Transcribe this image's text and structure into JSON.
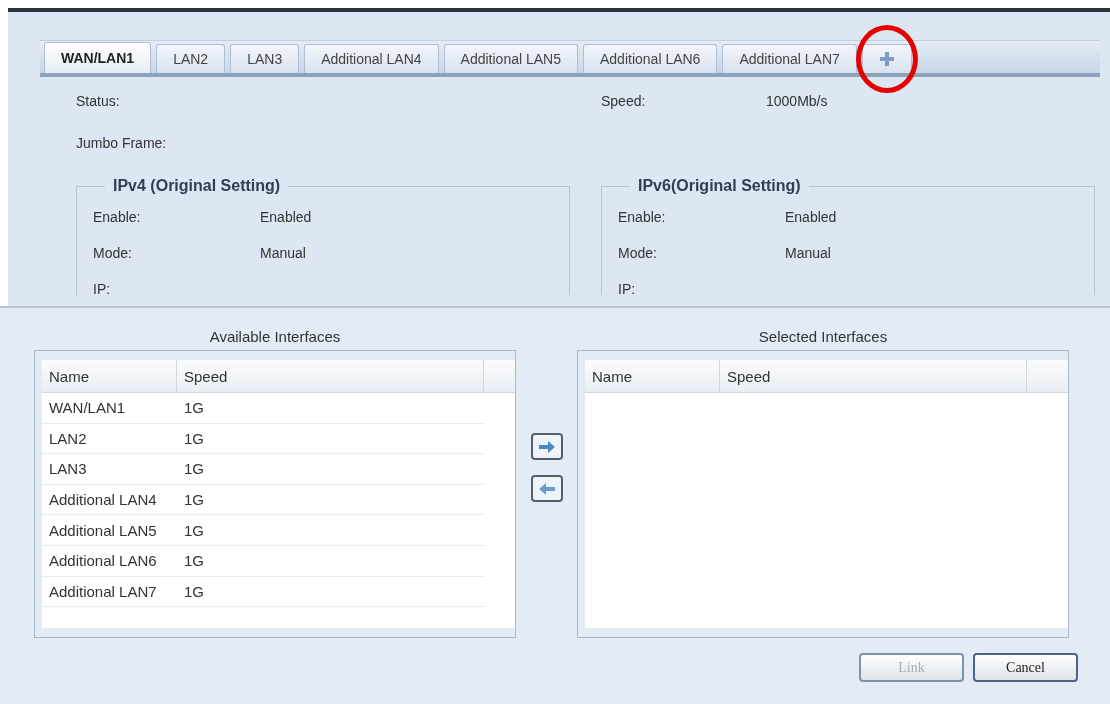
{
  "tabs": [
    {
      "label": "WAN/LAN1",
      "selected": true
    },
    {
      "label": "LAN2",
      "selected": false
    },
    {
      "label": "LAN3",
      "selected": false
    },
    {
      "label": "Additional LAN4",
      "selected": false
    },
    {
      "label": "Additional LAN5",
      "selected": false
    },
    {
      "label": "Additional LAN6",
      "selected": false
    },
    {
      "label": "Additional LAN7",
      "selected": false
    }
  ],
  "add_tab": {
    "circled": true
  },
  "status": {
    "label": "Status:"
  },
  "speed": {
    "label": "Speed:",
    "value": "1000Mb/s"
  },
  "jumbo_frame": {
    "label": "Jumbo Frame:"
  },
  "ipv4": {
    "legend": "IPv4 (Original Setting)",
    "rows": [
      {
        "label": "Enable:",
        "value": "Enabled"
      },
      {
        "label": "Mode:",
        "value": "Manual"
      },
      {
        "label": "IP:"
      }
    ]
  },
  "ipv6": {
    "legend": "IPv6(Original Setting)",
    "rows": [
      {
        "label": "Enable:",
        "value": "Enabled"
      },
      {
        "label": "Mode:",
        "value": "Manual"
      },
      {
        "label": "IP:"
      }
    ]
  },
  "available": {
    "title": "Available Interfaces",
    "columns": [
      "Name",
      "Speed"
    ],
    "rows": [
      [
        "WAN/LAN1",
        "1G"
      ],
      [
        "LAN2",
        "1G"
      ],
      [
        "LAN3",
        "1G"
      ],
      [
        "Additional LAN4",
        "1G"
      ],
      [
        "Additional LAN5",
        "1G"
      ],
      [
        "Additional LAN6",
        "1G"
      ],
      [
        "Additional LAN7",
        "1G"
      ]
    ]
  },
  "selected": {
    "title": "Selected Interfaces",
    "columns": [
      "Name",
      "Speed"
    ]
  },
  "buttons": [
    {
      "label": "Link",
      "disabled": true
    },
    {
      "label": "Cancel",
      "disabled": false
    }
  ]
}
